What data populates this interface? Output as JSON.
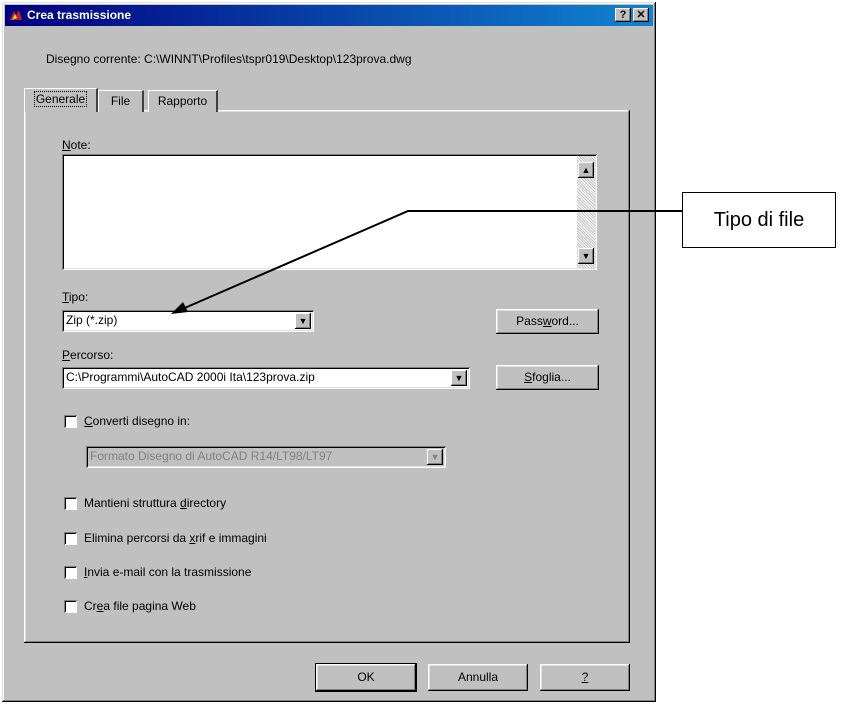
{
  "window": {
    "title": "Crea trasmissione",
    "help_btn": "?",
    "close_btn": "✕"
  },
  "current_drawing": "Disegno corrente: C:\\WINNT\\Profiles\\tspr019\\Desktop\\123prova.dwg",
  "tabs": [
    {
      "label": "Generale",
      "active": true
    },
    {
      "label": "File",
      "active": false
    },
    {
      "label": "Rapporto",
      "active": false
    }
  ],
  "note": {
    "label_first": "N",
    "label_rest": "ote:",
    "value": ""
  },
  "tipo": {
    "label_first": "T",
    "label_rest": "ipo:",
    "value": "Zip (*.zip)"
  },
  "password_button": {
    "pre": "Pass",
    "ul": "w",
    "post": "ord..."
  },
  "percorso": {
    "label_first": "P",
    "label_rest": "ercorso:",
    "value": "C:\\Programmi\\AutoCAD 2000i Ita\\123prova.zip"
  },
  "sfoglia_button": {
    "ul": "S",
    "post": "foglia..."
  },
  "converti": {
    "ul": "C",
    "post": "onverti disegno in:",
    "checked": false,
    "format_value": "Formato Disegno di AutoCAD R14/LT98/LT97"
  },
  "options": [
    {
      "pre": "Mantieni struttura ",
      "ul": "d",
      "post": "irectory",
      "checked": false
    },
    {
      "pre": "Elimina percorsi da ",
      "ul": "x",
      "post": "rif e immagini",
      "checked": false
    },
    {
      "pre": "",
      "ul": "I",
      "post": "nvia e-mail con la trasmissione",
      "checked": false
    },
    {
      "pre": "Cr",
      "ul": "e",
      "post": "a file pagina Web",
      "checked": false
    }
  ],
  "buttons": {
    "ok": "OK",
    "annulla": "Annulla",
    "help": "?"
  },
  "callout": {
    "text": "Tipo di file"
  }
}
